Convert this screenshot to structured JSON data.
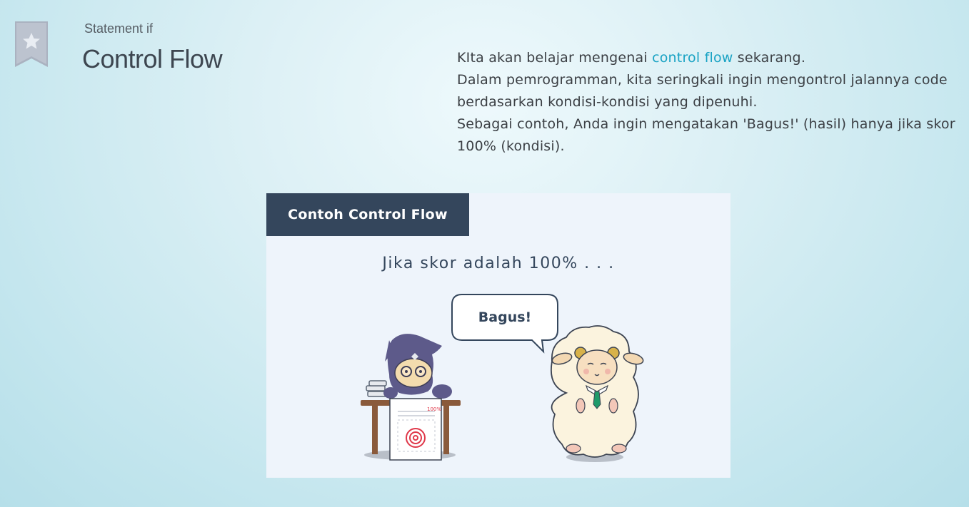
{
  "header": {
    "subtitle": "Statement if",
    "title": "Control Flow"
  },
  "intro": {
    "line1_before": "KIta akan belajar mengenai ",
    "line1_link": "control flow",
    "line1_after": " sekarang.",
    "para2": "Dalam pemrogramman, kita seringkali ingin mengontrol jalannya code berdasarkan kondisi-kondisi yang dipenuhi.",
    "para3": "Sebagai contoh, Anda ingin mengatakan 'Bagus!' (hasil) hanya jika skor 100% (kondisi)."
  },
  "card": {
    "header": "Contoh Control Flow",
    "condition": "Jika skor adalah 100% . . .",
    "bubble": "Bagus!",
    "paper_score": "100%"
  },
  "icons": {
    "bookmark": "star-bookmark-icon"
  },
  "colors": {
    "link": "#1aa3c4",
    "card_header_bg": "#34465c",
    "card_bg": "#eef4fb"
  }
}
